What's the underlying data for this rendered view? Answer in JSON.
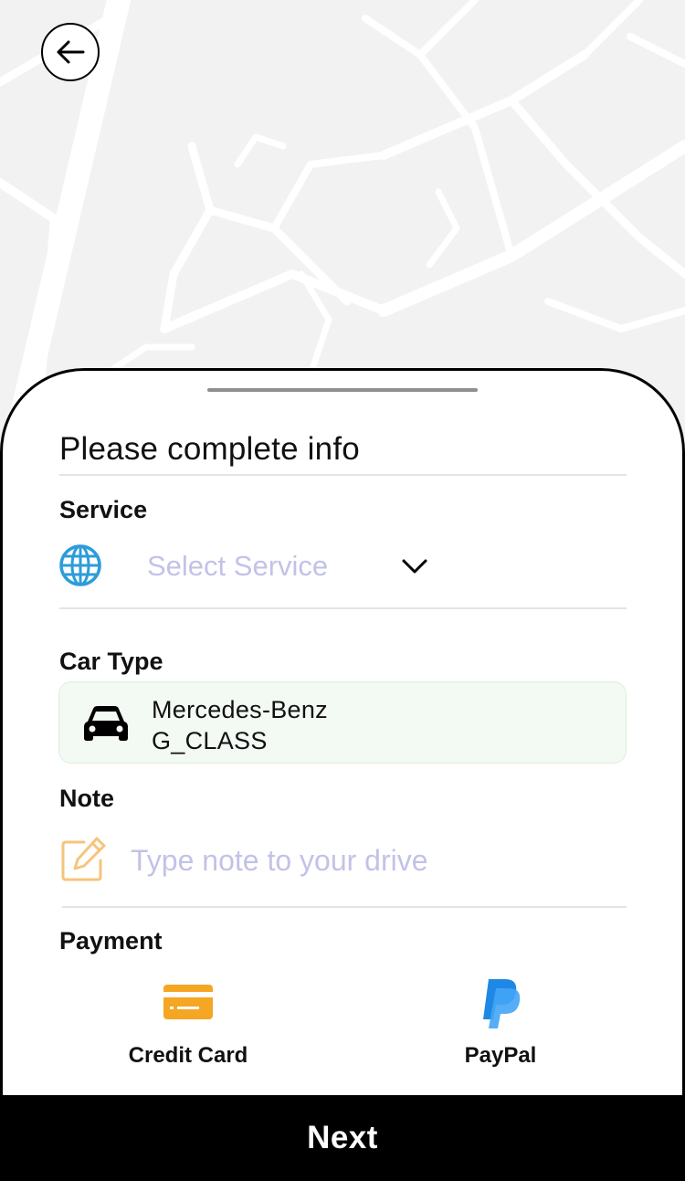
{
  "sheet": {
    "title": "Please complete info"
  },
  "service": {
    "label": "Service",
    "placeholder": "Select Service",
    "icon": "globe-icon"
  },
  "car_type": {
    "label": "Car Type",
    "line1": "Mercedes-Benz",
    "line2": "G_CLASS",
    "icon": "car-icon"
  },
  "note": {
    "label": "Note",
    "placeholder": "Type note to your drive",
    "icon": "edit-note-icon"
  },
  "payment": {
    "label": "Payment",
    "options": [
      {
        "label": "Credit Card",
        "icon": "credit-card-icon",
        "color": "#f5a623"
      },
      {
        "label": "PayPal",
        "icon": "paypal-icon",
        "color": "#2196f3"
      }
    ]
  },
  "footer": {
    "next_label": "Next"
  },
  "colors": {
    "placeholder": "#c2c2e8",
    "accent_blue": "#2d9cdb",
    "accent_orange": "#f5a623",
    "car_box_bg": "#f3f9f3"
  }
}
